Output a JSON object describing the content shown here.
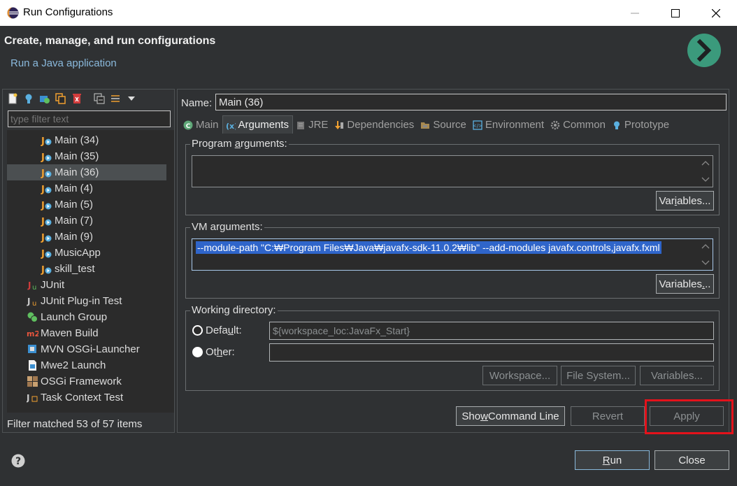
{
  "window": {
    "title": "Run Configurations"
  },
  "header": {
    "title": "Create, manage, and run configurations",
    "subtitle": "Run a Java application"
  },
  "left": {
    "filter_placeholder": "type filter text",
    "items": [
      {
        "label": "Main (34)",
        "icon": "java-app-icon",
        "level": 2,
        "selected": false
      },
      {
        "label": "Main (35)",
        "icon": "java-app-icon",
        "level": 2,
        "selected": false
      },
      {
        "label": "Main (36)",
        "icon": "java-app-icon",
        "level": 2,
        "selected": true
      },
      {
        "label": "Main (4)",
        "icon": "java-app-icon",
        "level": 2,
        "selected": false
      },
      {
        "label": "Main (5)",
        "icon": "java-app-icon",
        "level": 2,
        "selected": false
      },
      {
        "label": "Main (7)",
        "icon": "java-app-icon",
        "level": 2,
        "selected": false
      },
      {
        "label": "Main (9)",
        "icon": "java-app-icon",
        "level": 2,
        "selected": false
      },
      {
        "label": "MusicApp",
        "icon": "java-app-icon",
        "level": 2,
        "selected": false
      },
      {
        "label": "skill_test",
        "icon": "java-app-icon",
        "level": 2,
        "selected": false
      },
      {
        "label": "JUnit",
        "icon": "junit-icon",
        "level": 1,
        "selected": false
      },
      {
        "label": "JUnit Plug-in Test",
        "icon": "junit-plugin-icon",
        "level": 1,
        "selected": false
      },
      {
        "label": "Launch Group",
        "icon": "launch-group-icon",
        "level": 1,
        "selected": false
      },
      {
        "label": "Maven Build",
        "icon": "maven-icon",
        "level": 1,
        "selected": false
      },
      {
        "label": "MVN OSGi-Launcher",
        "icon": "mvn-osgi-icon",
        "level": 1,
        "selected": false
      },
      {
        "label": "Mwe2 Launch",
        "icon": "mwe2-icon",
        "level": 1,
        "selected": false
      },
      {
        "label": "OSGi Framework",
        "icon": "osgi-icon",
        "level": 1,
        "selected": false
      },
      {
        "label": "Task Context Test",
        "icon": "task-context-icon",
        "level": 1,
        "selected": false
      }
    ],
    "filter_status": "Filter matched 53 of 57 items"
  },
  "right": {
    "name_label": "Name:",
    "name_value": "Main (36)",
    "tabs": [
      {
        "label": "Main",
        "icon": "main-tab-icon",
        "active": false
      },
      {
        "label": "Arguments",
        "icon": "arguments-tab-icon",
        "active": true
      },
      {
        "label": "JRE",
        "icon": "jre-tab-icon",
        "active": false
      },
      {
        "label": "Dependencies",
        "icon": "dependencies-tab-icon",
        "active": false
      },
      {
        "label": "Source",
        "icon": "source-tab-icon",
        "active": false
      },
      {
        "label": "Environment",
        "icon": "environment-tab-icon",
        "active": false
      },
      {
        "label": "Common",
        "icon": "common-tab-icon",
        "active": false
      },
      {
        "label": "Prototype",
        "icon": "prototype-tab-icon",
        "active": false
      }
    ],
    "program_args_label": "Program arguments:",
    "program_args_value": "",
    "vm_args_label": "VM arguments:",
    "vm_args_value": "--module-path \"C:₩Program Files₩Java₩javafx-sdk-11.0.2₩lib\" --add-modules javafx.controls,javafx.fxml",
    "variables_label": "Variables...",
    "working_dir_label": "Working directory:",
    "default_label": "Default:",
    "default_value": "${workspace_loc:JavaFx_Start}",
    "other_label": "Other:",
    "other_value": "",
    "workspace_label": "Workspace...",
    "filesystem_label": "File System...",
    "show_cmd_label": "Show Command Line",
    "revert_label": "Revert",
    "apply_label": "Apply"
  },
  "footer": {
    "run_label": "Run",
    "close_label": "Close"
  },
  "colors": {
    "accent": "#2f65ca",
    "highlight": "#e4121b",
    "run_icon": "#3b9a7c"
  }
}
